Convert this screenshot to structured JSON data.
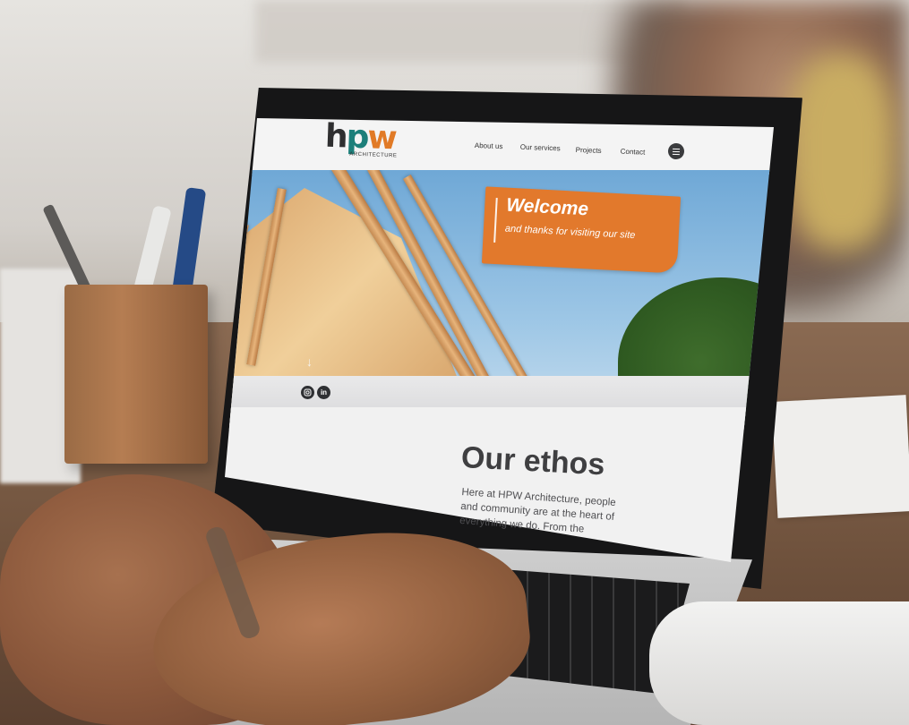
{
  "logo": {
    "mark_h": "h",
    "mark_p": "p",
    "mark_w": "w",
    "subtitle": "ARCHITECTURE"
  },
  "nav": {
    "items": [
      {
        "label": "About us"
      },
      {
        "label": "Our services"
      },
      {
        "label": "Projects"
      },
      {
        "label": "Contact"
      }
    ],
    "menu_icon": "hamburger-menu-icon"
  },
  "hero": {
    "welcome_title": "Welcome",
    "welcome_subtitle": "and thanks for visiting our site",
    "accent_color": "#e2792c",
    "scroll_icon": "arrow-down-icon"
  },
  "social": {
    "instagram_icon": "instagram-icon",
    "linkedin_label": "in",
    "linkedin_icon": "linkedin-icon"
  },
  "ethos": {
    "title": "Our ethos",
    "text": "Here at HPW Architecture, people and community are at the heart of everything we do. From the"
  }
}
